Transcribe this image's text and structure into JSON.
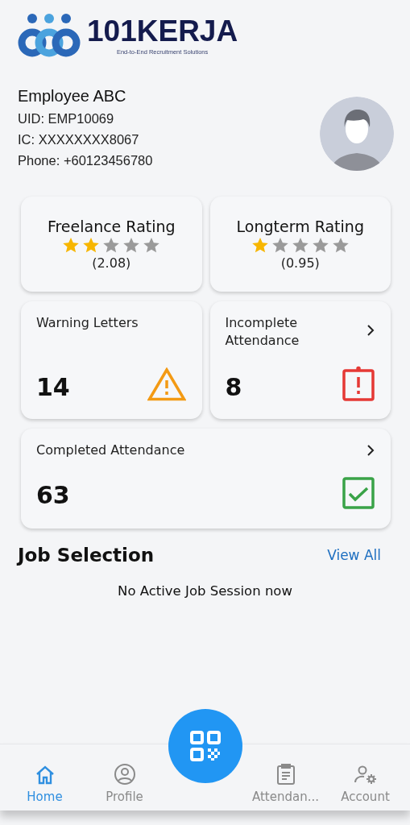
{
  "logo": {
    "name": "101KERJA",
    "tagline": "End-to-End Recruitment Solutions"
  },
  "profile": {
    "name": "Employee ABC",
    "lines": [
      "UID: EMP10069",
      "IC: XXXXXXXX8067",
      "Phone: +60123456780"
    ]
  },
  "ratings": [
    {
      "title": "Freelance Rating",
      "stars": 2,
      "value": "(2.08)"
    },
    {
      "title": "Longterm Rating",
      "stars": 1,
      "value": "(0.95)"
    }
  ],
  "stats": [
    {
      "kind": "warning",
      "label": "Warning Letters",
      "count": "14",
      "arrow": false,
      "wide": false
    },
    {
      "kind": "incomplete",
      "label": "Incomplete Attendance",
      "count": "8",
      "arrow": true,
      "wide": false
    },
    {
      "kind": "completed",
      "label": "Completed Attendance",
      "count": "63",
      "arrow": true,
      "wide": true
    }
  ],
  "job_selection": {
    "title": "Job Selection",
    "link": "View All",
    "empty": "No Active Job Session now"
  },
  "nav": [
    {
      "kind": "home",
      "label": "Home",
      "selected": true
    },
    {
      "kind": "profile",
      "label": "Profile",
      "selected": false
    },
    {
      "kind": "scan",
      "selected": false
    },
    {
      "kind": "attendance",
      "label": "Attendan...",
      "selected": false
    },
    {
      "kind": "account",
      "label": "Account",
      "selected": false
    }
  ]
}
